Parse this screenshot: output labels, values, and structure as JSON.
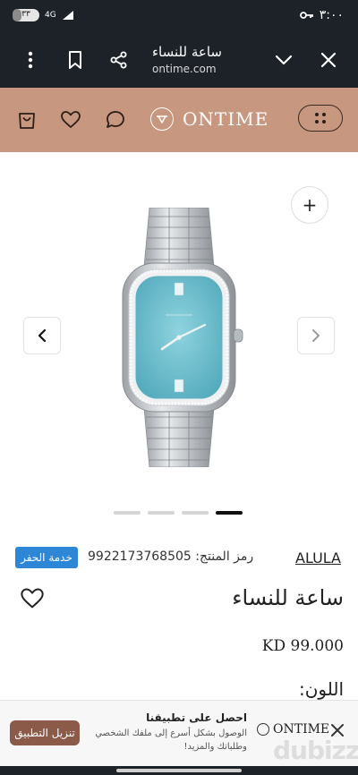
{
  "status_bar": {
    "time": "٣:٠٠",
    "battery_text": "٣٣",
    "battery_level": 0.33,
    "network": "4G"
  },
  "browser": {
    "page_title": "ساعة للنساء",
    "url": "ontime.com"
  },
  "site": {
    "logo_text": "ONTIME",
    "accent_color": "#c8977f",
    "icons": [
      "bag-icon",
      "heart-icon",
      "chat-icon",
      "grid-dots-icon"
    ]
  },
  "gallery": {
    "zoom_label": "+",
    "slide_count": 4,
    "active_slide": 4
  },
  "product": {
    "service_badge": "خدمة الحفر",
    "sku_label": "رمز المنتج:",
    "sku_value": "9922173768505",
    "brand": "ALULA",
    "title": "ساعة للنساء",
    "price": "KD 99.000",
    "color_label": "اللون:"
  },
  "app_banner": {
    "logo_text": "ONTIME",
    "title": "احصل على تطبيقنا",
    "description": "الوصول بشكل أسرع إلى ملفك الشخصي وطلباتك والمزيد!",
    "install_label": "تنزيل التطبيق",
    "button_color": "#8c5a48"
  },
  "watermark": "dubizzle"
}
